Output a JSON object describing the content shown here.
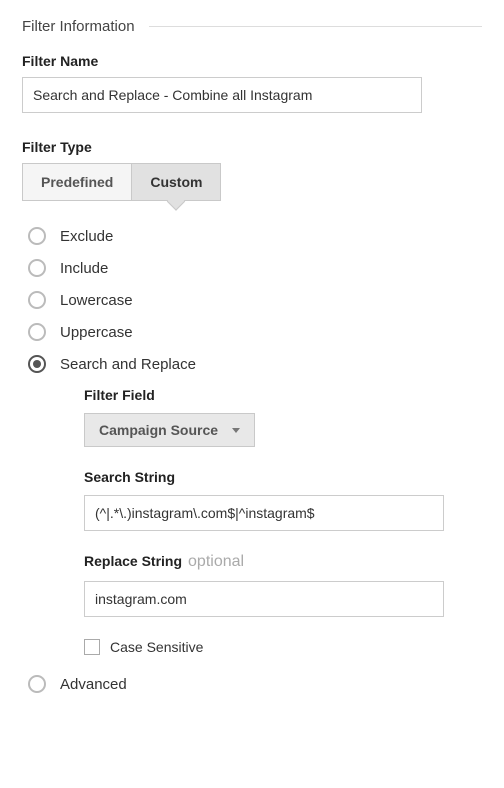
{
  "legend": "Filter Information",
  "filterName": {
    "label": "Filter Name",
    "value": "Search and Replace - Combine all Instagram"
  },
  "filterType": {
    "label": "Filter Type",
    "tabs": {
      "predefined": "Predefined",
      "custom": "Custom"
    }
  },
  "radios": {
    "exclude": "Exclude",
    "include": "Include",
    "lowercase": "Lowercase",
    "uppercase": "Uppercase",
    "searchReplace": "Search and Replace",
    "advanced": "Advanced"
  },
  "searchReplace": {
    "filterField": {
      "label": "Filter Field",
      "value": "Campaign Source"
    },
    "searchString": {
      "label": "Search String",
      "value": "(^|.*\\.)instagram\\.com$|^instagram$"
    },
    "replaceString": {
      "label": "Replace String",
      "optional": "optional",
      "value": "instagram.com"
    },
    "caseSensitive": "Case Sensitive"
  }
}
